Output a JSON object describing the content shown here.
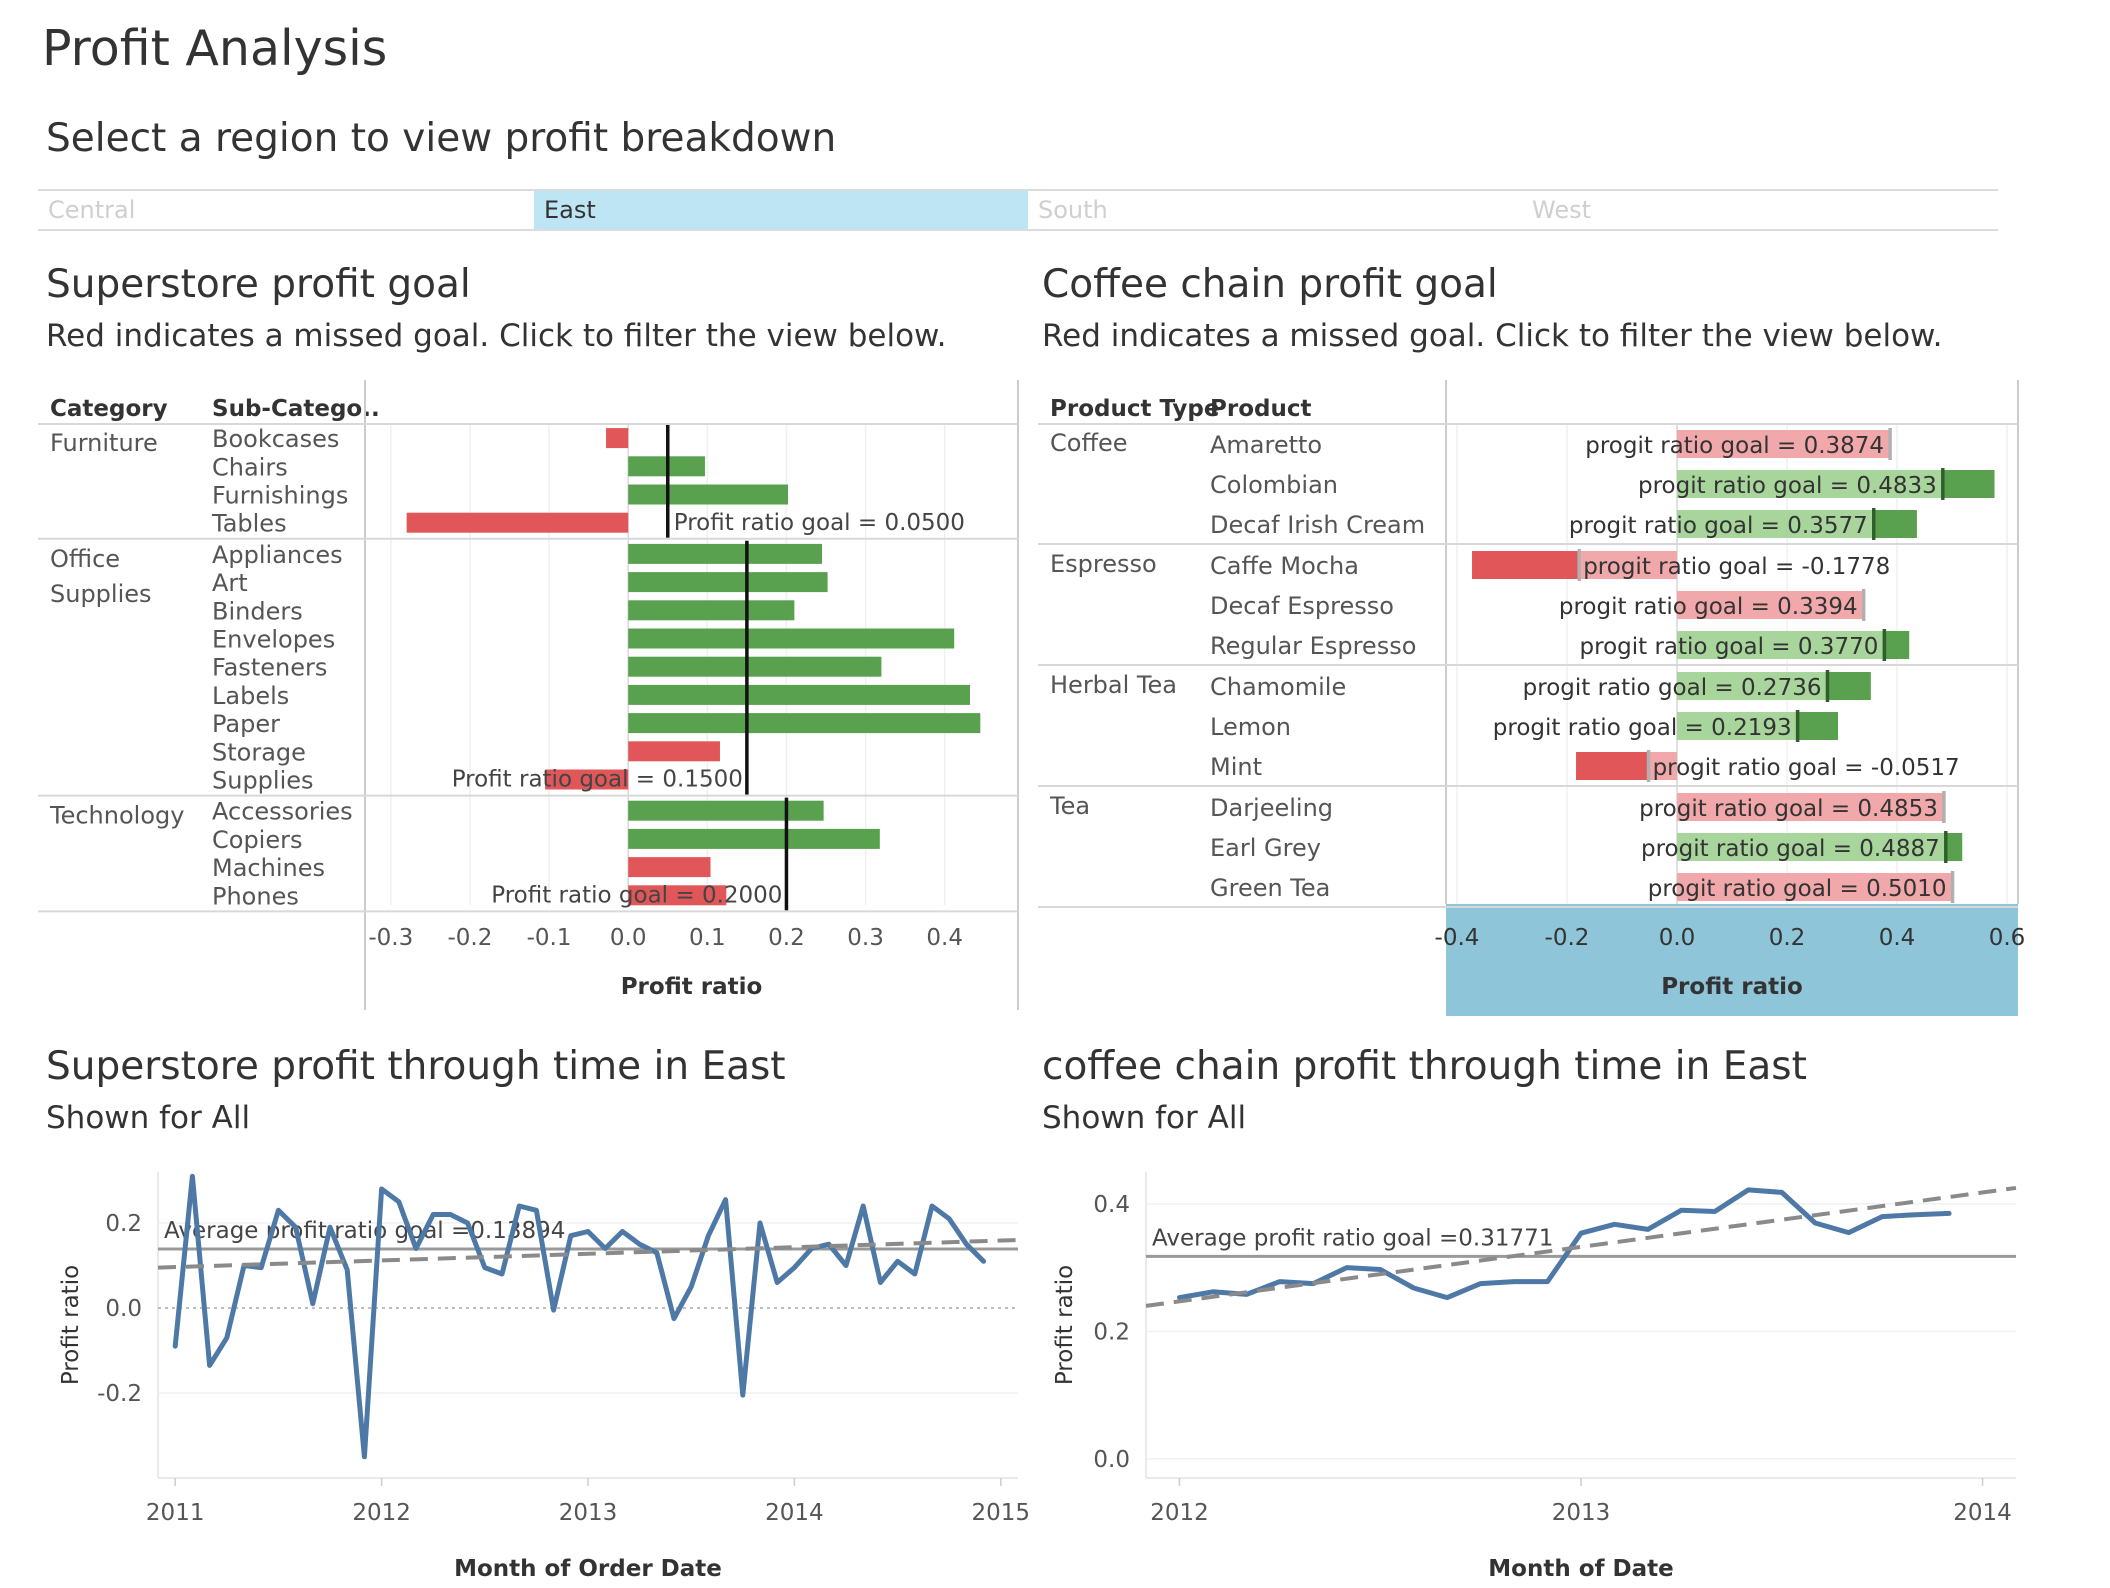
{
  "page": {
    "title": "Profit Analysis",
    "region_prompt": "Select a region to view profit breakdown",
    "regions": [
      "Central",
      "East",
      "South",
      "West"
    ],
    "selected_region": "East"
  },
  "colors": {
    "good": "#59a14f",
    "good_light": "#a7d59b",
    "bad": "#e15759",
    "bad_light": "#f1a8ab",
    "line": "#4e79a7",
    "selected_region": "#bee5f3",
    "selected_axis": "#8fc5d8"
  },
  "superstore_goal": {
    "title": "Superstore profit goal",
    "subtitle": "Red indicates a missed goal. Click to filter the view below.",
    "headers": [
      "Category",
      "Sub-Catego.."
    ],
    "chart_data": {
      "type": "bar",
      "orientation": "horizontal",
      "xlabel": "Profit ratio",
      "xlim": [
        -0.32,
        0.48
      ],
      "xticks": [
        "-0.3",
        "-0.2",
        "-0.1",
        "0.0",
        "0.1",
        "0.2",
        "0.3",
        "0.4"
      ],
      "groups": [
        {
          "category": "Furniture",
          "goal_label": "Profit ratio goal = 0.0500",
          "goal": 0.05,
          "items": [
            {
              "name": "Bookcases",
              "value": -0.028
            },
            {
              "name": "Chairs",
              "value": 0.097
            },
            {
              "name": "Furnishings",
              "value": 0.202
            },
            {
              "name": "Tables",
              "value": -0.28
            }
          ]
        },
        {
          "category": "Office\nSupplies",
          "goal_label": "Profit ratio goal = 0.1500",
          "goal": 0.15,
          "items": [
            {
              "name": "Appliances",
              "value": 0.245
            },
            {
              "name": "Art",
              "value": 0.252
            },
            {
              "name": "Binders",
              "value": 0.21
            },
            {
              "name": "Envelopes",
              "value": 0.412
            },
            {
              "name": "Fasteners",
              "value": 0.32
            },
            {
              "name": "Labels",
              "value": 0.432
            },
            {
              "name": "Paper",
              "value": 0.445
            },
            {
              "name": "Storage",
              "value": 0.116
            },
            {
              "name": "Supplies",
              "value": -0.105
            }
          ]
        },
        {
          "category": "Technology",
          "goal_label": "Profit ratio goal = 0.2000",
          "goal": 0.2,
          "items": [
            {
              "name": "Accessories",
              "value": 0.247
            },
            {
              "name": "Copiers",
              "value": 0.318
            },
            {
              "name": "Machines",
              "value": 0.104
            },
            {
              "name": "Phones",
              "value": 0.124
            }
          ]
        }
      ]
    }
  },
  "coffee_goal": {
    "title": "Coffee chain profit goal",
    "subtitle": "Red indicates a missed goal. Click to filter the view below.",
    "headers": [
      "Product Type",
      "Product"
    ],
    "chart_data": {
      "type": "bar",
      "orientation": "horizontal",
      "xlabel": "Profit ratio",
      "xlim": [
        -0.42,
        0.62
      ],
      "xticks": [
        "-0.4",
        "-0.2",
        "0.0",
        "0.2",
        "0.4",
        "0.6"
      ],
      "groups": [
        {
          "category": "Coffee",
          "items": [
            {
              "name": "Amaretto",
              "value": 0.3425,
              "goal": 0.3874,
              "goal_label": "progit ratio goal = 0.3874"
            },
            {
              "name": "Colombian",
              "value": 0.5773,
              "goal": 0.4833,
              "goal_label": "progit ratio goal = 0.4833"
            },
            {
              "name": "Decaf Irish Cream",
              "value": 0.4362,
              "goal": 0.3577,
              "goal_label": "progit ratio goal = 0.3577"
            }
          ]
        },
        {
          "category": "Espresso",
          "items": [
            {
              "name": "Caffe Mocha",
              "value": -0.3727,
              "goal": -0.1778,
              "goal_label": "progit ratio goal = -0.1778"
            },
            {
              "name": "Decaf Espresso",
              "value": 0.3174,
              "goal": 0.3394,
              "goal_label": "progit ratio goal = 0.3394"
            },
            {
              "name": "Regular Espresso",
              "value": 0.4222,
              "goal": 0.377,
              "goal_label": "progit ratio goal = 0.3770"
            }
          ]
        },
        {
          "category": "Herbal Tea",
          "items": [
            {
              "name": "Chamomile",
              "value": 0.3524,
              "goal": 0.2736,
              "goal_label": "progit ratio goal = 0.2736"
            },
            {
              "name": "Lemon",
              "value": 0.2928,
              "goal": 0.2193,
              "goal_label": "progit ratio goal = 0.2193"
            },
            {
              "name": "Mint",
              "value": -0.1836,
              "goal": -0.0517,
              "goal_label": "progit ratio goal = -0.0517"
            }
          ]
        },
        {
          "category": "Tea",
          "items": [
            {
              "name": "Darjeeling",
              "value": 0.4613,
              "goal": 0.4853,
              "goal_label": "progit ratio goal = 0.4853"
            },
            {
              "name": "Earl Grey",
              "value": 0.5186,
              "goal": 0.4887,
              "goal_label": "progit ratio goal = 0.4887"
            },
            {
              "name": "Green Tea",
              "value": 0.4862,
              "goal": 0.501,
              "goal_label": "progit ratio goal = 0.5010"
            }
          ]
        }
      ]
    }
  },
  "superstore_time": {
    "title": "Superstore profit through time in East",
    "subtitle": "Shown for All",
    "chart_data": {
      "type": "line",
      "xlabel": "Month of Order Date",
      "ylabel": "Profit ratio",
      "x_range": [
        "2010-12",
        "2015-02"
      ],
      "ylim": [
        -0.4,
        0.32
      ],
      "xticks": [
        "2011",
        "2012",
        "2013",
        "2014",
        "2015"
      ],
      "yticks": [
        "0.2",
        "0.0",
        "-0.2"
      ],
      "reference_label": "Average profit ratio goal =0.13894",
      "reference_value": 0.13894,
      "trend": {
        "start": [
          "2010-12",
          0.095
        ],
        "end": [
          "2015-02",
          0.16
        ]
      },
      "series": [
        {
          "x": [
            "2011-01",
            "2011-02",
            "2011-03",
            "2011-04",
            "2011-05",
            "2011-06",
            "2011-07",
            "2011-08",
            "2011-09",
            "2011-10",
            "2011-11",
            "2011-12",
            "2012-01",
            "2012-02",
            "2012-03",
            "2012-04",
            "2012-05",
            "2012-06",
            "2012-07",
            "2012-08",
            "2012-09",
            "2012-10",
            "2012-11",
            "2012-12",
            "2013-01",
            "2013-02",
            "2013-03",
            "2013-04",
            "2013-05",
            "2013-06",
            "2013-07",
            "2013-08",
            "2013-09",
            "2013-10",
            "2013-11",
            "2013-12",
            "2014-01",
            "2014-02",
            "2014-03",
            "2014-04",
            "2014-05",
            "2014-06",
            "2014-07",
            "2014-08",
            "2014-09",
            "2014-10",
            "2014-11",
            "2014-12"
          ],
          "y": [
            -0.09,
            0.31,
            -0.135,
            -0.07,
            0.1,
            0.095,
            0.23,
            0.19,
            0.01,
            0.19,
            0.09,
            -0.35,
            0.28,
            0.25,
            0.14,
            0.22,
            0.22,
            0.2,
            0.095,
            0.08,
            0.24,
            0.23,
            -0.005,
            0.17,
            0.18,
            0.14,
            0.18,
            0.15,
            0.13,
            -0.025,
            0.05,
            0.17,
            0.255,
            -0.205,
            0.2,
            0.06,
            0.095,
            0.14,
            0.15,
            0.1,
            0.24,
            0.06,
            0.11,
            0.08,
            0.24,
            0.21,
            0.15,
            0.11
          ]
        }
      ]
    }
  },
  "coffee_time": {
    "title": "coffee chain profit through time in East",
    "subtitle": "Shown for All",
    "chart_data": {
      "type": "line",
      "xlabel": "Month of Date",
      "ylabel": "Profit ratio",
      "x_range": [
        "2011-12",
        "2014-02"
      ],
      "ylim": [
        -0.03,
        0.45
      ],
      "xticks": [
        "2012",
        "2013",
        "2014"
      ],
      "yticks": [
        "0.4",
        "0.2",
        "0.0"
      ],
      "reference_label": "Average profit ratio goal =0.31771",
      "reference_value": 0.31771,
      "trend": {
        "start": [
          "2011-12",
          0.24
        ],
        "end": [
          "2014-02",
          0.425
        ]
      },
      "series": [
        {
          "x": [
            "2012-01",
            "2012-02",
            "2012-03",
            "2012-04",
            "2012-05",
            "2012-06",
            "2012-07",
            "2012-08",
            "2012-09",
            "2012-10",
            "2012-11",
            "2012-12",
            "2013-01",
            "2013-02",
            "2013-03",
            "2013-04",
            "2013-05",
            "2013-06",
            "2013-07",
            "2013-08",
            "2013-09",
            "2013-10",
            "2013-11",
            "2013-12"
          ],
          "y": [
            0.253,
            0.262,
            0.258,
            0.278,
            0.275,
            0.3,
            0.297,
            0.268,
            0.253,
            0.275,
            0.278,
            0.278,
            0.354,
            0.368,
            0.36,
            0.39,
            0.388,
            0.422,
            0.418,
            0.37,
            0.355,
            0.38,
            0.383,
            0.385
          ]
        }
      ]
    }
  }
}
